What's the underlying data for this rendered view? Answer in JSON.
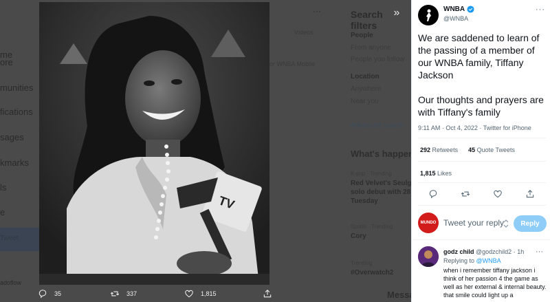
{
  "background": {
    "nav_items": [
      "me",
      "ore",
      "munities",
      "fications",
      "sages",
      "kmarks",
      "ls",
      "e",
      "Tweet",
      "adoflow"
    ],
    "search_title": "Search filters",
    "people_label": "People",
    "people_options": [
      "From anyone",
      "People you follow"
    ],
    "location_label": "Location",
    "location_options": [
      "Anywhere",
      "Near you"
    ],
    "advanced": "Advanced search",
    "whats_happening": "What's happening",
    "trend1_meta": "K-pop · Trending",
    "trend1_title": "Red Velvet's Seulgi",
    "trend1_sub": "solo debut with 28",
    "trend1_day": "Tuesday",
    "trend2_meta": "Sports · Trending",
    "trend2_title": "Cory",
    "trend3_meta": "Trending",
    "trend3_title": "#Overwatch2",
    "videos": "Videos",
    "mobile": "or WNBA Mobile",
    "messages": "Messages"
  },
  "media_actions": {
    "replies": "35",
    "retweets": "337",
    "likes": "1,815"
  },
  "tweet": {
    "author_name": "WNBA",
    "author_handle": "@WNBA",
    "text": "We are saddened to learn of the passing of a member of our WNBA family, Tiffany Jackson\n\nOur thoughts and prayers are with Tiffany's family",
    "time": "9:11 AM",
    "date": "Oct 4, 2022",
    "source": "Twitter for iPhone",
    "retweets_count": "292",
    "retweets_label": "Retweets",
    "quotes_count": "45",
    "quotes_label": "Quote Tweets",
    "likes_count": "1,815",
    "likes_label": "Likes"
  },
  "compose": {
    "placeholder": "Tweet your reply",
    "avatar_text": "MUNDO",
    "reply_button": "Reply"
  },
  "reply": {
    "name": "godz child",
    "handle": "@godzchild2",
    "age": "1h",
    "replying_prefix": "Replying to",
    "replying_to": "@WNBA",
    "text": "when i remember tiffany jackson i think of her passion 4  the game as well as her external & internal beauty. that smile could light up a"
  },
  "colors": {
    "accent": "#1d9bf0",
    "reply_button": "#8ecdf8",
    "overlay": "#4a4a4a"
  }
}
